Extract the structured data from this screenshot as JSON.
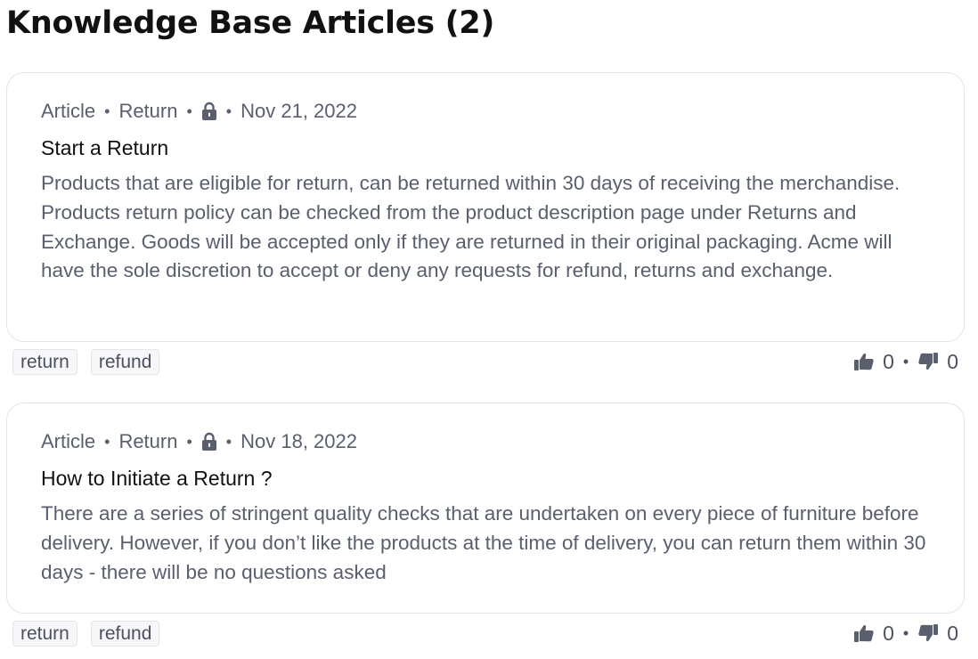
{
  "header": {
    "title": "Knowledge Base Articles (2)"
  },
  "colors": {
    "card_border": "#e3e4e8",
    "secondary_text": "#5a5f6d",
    "tag_background": "#f7f7f9",
    "icon": "#5a5f6d"
  },
  "articles": [
    {
      "type": "Article",
      "category": "Return",
      "lock_icon": "lock-icon",
      "date": "Nov 21, 2022",
      "title": "Start a Return",
      "body": "Products that are eligible for return, can be returned within 30 days of receiving the merchandise. Products return policy can be checked from the product description page under Returns and Exchange. Goods will be accepted only if they are returned in their original packaging. Acme will have the sole discretion to accept or deny any requests for refund, returns and exchange.",
      "tags": [
        "return",
        "refund"
      ],
      "thumbs_up": "0",
      "thumbs_down": "0"
    },
    {
      "type": "Article",
      "category": "Return",
      "lock_icon": "lock-icon",
      "date": "Nov 18, 2022",
      "title": "How to Initiate a Return ?",
      "body": "There are a series of stringent quality checks that are undertaken on every piece of furniture before delivery. However, if you don’t like the products at the time of delivery, you can return them within 30 days - there will be no questions asked",
      "tags": [
        "return",
        "refund"
      ],
      "thumbs_up": "0",
      "thumbs_down": "0"
    }
  ],
  "separator": "•"
}
